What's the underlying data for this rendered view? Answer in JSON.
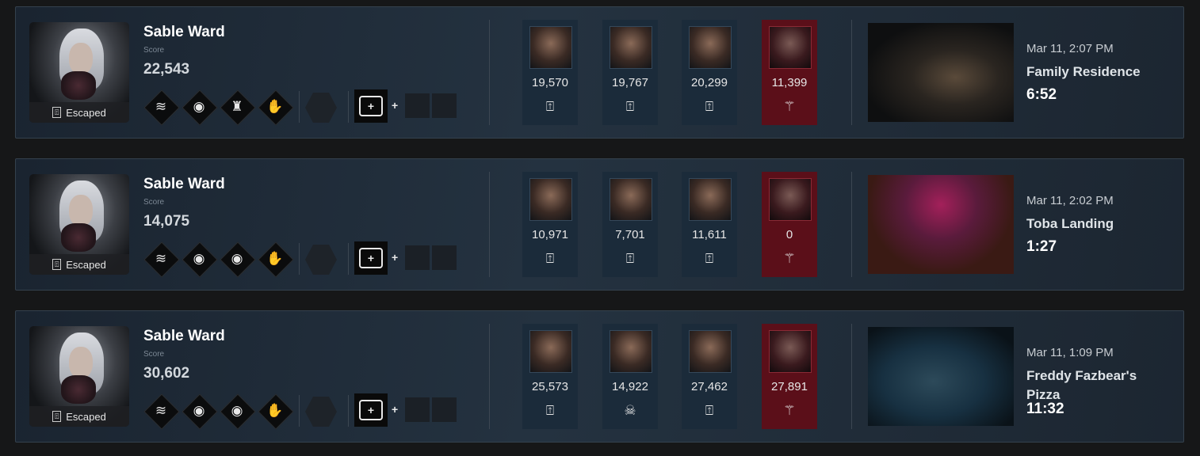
{
  "matches": [
    {
      "name": "Sable Ward",
      "score_label": "Score",
      "score": "22,543",
      "status": "Escaped",
      "perks": [
        "lightweight-icon",
        "kindred-icon",
        "hope-icon",
        "we-ll-make-it-icon"
      ],
      "item_icon": "medkit-icon",
      "players": [
        {
          "score": "19,570",
          "status_icon": "escaped-icon",
          "status_glyph": "⍐",
          "killer": false
        },
        {
          "score": "19,767",
          "status_icon": "escaped-icon",
          "status_glyph": "⍐",
          "killer": false
        },
        {
          "score": "20,299",
          "status_icon": "escaped-icon",
          "status_glyph": "⍐",
          "killer": false
        },
        {
          "score": "11,399",
          "status_icon": "killer-icon",
          "status_glyph": "⚚",
          "killer": true
        }
      ],
      "date": "Mar 11, 2:07 PM",
      "map": "Family Residence",
      "duration": "6:52"
    },
    {
      "name": "Sable Ward",
      "score_label": "Score",
      "score": "14,075",
      "status": "Escaped",
      "perks": [
        "lightweight-icon",
        "kindred-icon",
        "kindred-icon",
        "we-ll-make-it-icon"
      ],
      "item_icon": "medkit-icon",
      "players": [
        {
          "score": "10,971",
          "status_icon": "escaped-icon",
          "status_glyph": "⍐",
          "killer": false
        },
        {
          "score": "7,701",
          "status_icon": "escaped-icon",
          "status_glyph": "⍐",
          "killer": false
        },
        {
          "score": "11,611",
          "status_icon": "escaped-icon",
          "status_glyph": "⍐",
          "killer": false
        },
        {
          "score": "0",
          "status_icon": "killer-icon",
          "status_glyph": "⚚",
          "killer": true
        }
      ],
      "date": "Mar 11, 2:02 PM",
      "map": "Toba Landing",
      "duration": "1:27"
    },
    {
      "name": "Sable Ward",
      "score_label": "Score",
      "score": "30,602",
      "status": "Escaped",
      "perks": [
        "lightweight-icon",
        "kindred-icon",
        "kindred-icon",
        "we-ll-make-it-icon"
      ],
      "item_icon": "medkit-icon",
      "players": [
        {
          "score": "25,573",
          "status_icon": "escaped-icon",
          "status_glyph": "⍐",
          "killer": false
        },
        {
          "score": "14,922",
          "status_icon": "skull-icon",
          "status_glyph": "☠",
          "killer": false
        },
        {
          "score": "27,462",
          "status_icon": "escaped-icon",
          "status_glyph": "⍐",
          "killer": false
        },
        {
          "score": "27,891",
          "status_icon": "killer-icon",
          "status_glyph": "⚚",
          "killer": true
        }
      ],
      "date": "Mar 11, 1:09 PM",
      "map": "Freddy Fazbear's Pizza",
      "duration": "11:32"
    }
  ]
}
